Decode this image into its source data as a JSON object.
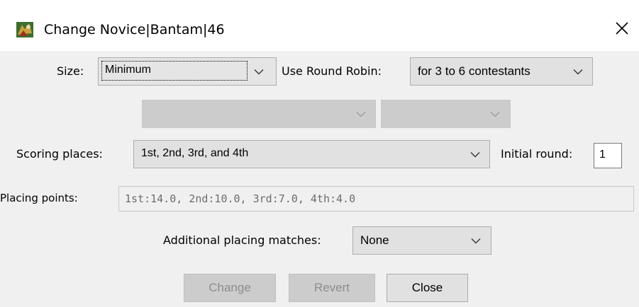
{
  "window": {
    "title": "Change Novice|Bantam|46",
    "icons": {
      "app": "app-logo-icon",
      "close": "close-icon"
    }
  },
  "size": {
    "label": "Size:",
    "value": "Minimum"
  },
  "round_robin": {
    "label": "Use Round Robin:",
    "value": "for 3 to 6 contestants"
  },
  "disabled_combos": [
    {
      "value": ""
    },
    {
      "value": ""
    }
  ],
  "scoring": {
    "label": "Scoring places:",
    "value": "1st, 2nd, 3rd, and 4th"
  },
  "initial_round": {
    "label": "Initial round:",
    "value": "1"
  },
  "placing_points": {
    "label": "Placing points:",
    "value": "1st:14.0, 2nd:10.0, 3rd:7.0, 4th:4.0"
  },
  "additional_placing": {
    "label": "Additional placing matches:",
    "value": "None"
  },
  "buttons": {
    "change": "Change",
    "revert": "Revert",
    "close": "Close"
  },
  "colors": {
    "background": "#f0f0f0",
    "titlebar": "#ffffff",
    "combo": "#e1e1e1",
    "disabled_text": "#8d8d8d"
  }
}
